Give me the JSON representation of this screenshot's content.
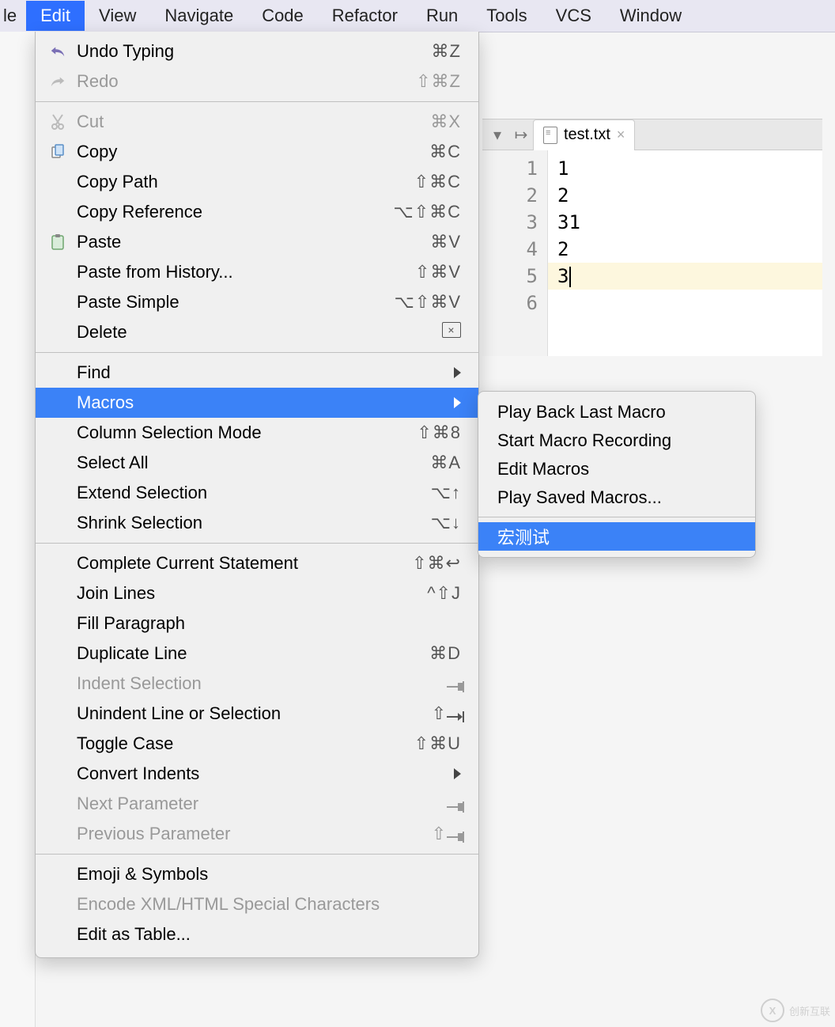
{
  "menubar": {
    "partial_left": "le",
    "items": [
      "Edit",
      "View",
      "Navigate",
      "Code",
      "Refactor",
      "Run",
      "Tools",
      "VCS",
      "Window"
    ],
    "active_index": 0
  },
  "edit_menu": [
    {
      "icon": "undo-icon",
      "label": "Undo Typing",
      "shortcut": "⌘Z"
    },
    {
      "icon": "redo-icon",
      "label": "Redo",
      "shortcut": "⇧⌘Z",
      "disabled": true
    },
    {
      "sep": true
    },
    {
      "icon": "cut-icon",
      "label": "Cut",
      "shortcut": "⌘X",
      "disabled": true
    },
    {
      "icon": "copy-icon",
      "label": "Copy",
      "shortcut": "⌘C"
    },
    {
      "label": "Copy Path",
      "shortcut": "⇧⌘C"
    },
    {
      "label": "Copy Reference",
      "shortcut": "⌥⇧⌘C"
    },
    {
      "icon": "paste-icon",
      "label": "Paste",
      "shortcut": "⌘V"
    },
    {
      "label": "Paste from History...",
      "shortcut": "⇧⌘V"
    },
    {
      "label": "Paste Simple",
      "shortcut": "⌥⇧⌘V"
    },
    {
      "label": "Delete",
      "shortcut_glyph": "delete"
    },
    {
      "sep": true
    },
    {
      "label": "Find",
      "submenu": true
    },
    {
      "label": "Macros",
      "submenu": true,
      "highlight": true
    },
    {
      "label": "Column Selection Mode",
      "shortcut": "⇧⌘8"
    },
    {
      "label": "Select All",
      "shortcut": "⌘A"
    },
    {
      "label": "Extend Selection",
      "shortcut": "⌥↑"
    },
    {
      "label": "Shrink Selection",
      "shortcut": "⌥↓"
    },
    {
      "sep": true
    },
    {
      "label": "Complete Current Statement",
      "shortcut": "⇧⌘↩"
    },
    {
      "label": "Join Lines",
      "shortcut": "^⇧J"
    },
    {
      "label": "Fill Paragraph"
    },
    {
      "label": "Duplicate Line",
      "shortcut": "⌘D"
    },
    {
      "label": "Indent Selection",
      "shortcut_glyph": "tab",
      "disabled": true
    },
    {
      "label": "Unindent Line or Selection",
      "shortcut": "⇧",
      "shortcut_glyph": "tab"
    },
    {
      "label": "Toggle Case",
      "shortcut": "⇧⌘U"
    },
    {
      "label": "Convert Indents",
      "submenu": true
    },
    {
      "label": "Next Parameter",
      "shortcut_glyph": "tab",
      "disabled": true
    },
    {
      "label": "Previous Parameter",
      "shortcut": "⇧",
      "shortcut_glyph": "tab",
      "disabled": true
    },
    {
      "sep": true
    },
    {
      "label": "Emoji & Symbols"
    },
    {
      "label": "Encode XML/HTML Special Characters",
      "disabled": true
    },
    {
      "label": "Edit as Table..."
    }
  ],
  "macros_submenu": [
    {
      "label": "Play Back Last Macro"
    },
    {
      "label": "Start Macro Recording"
    },
    {
      "label": "Edit Macros"
    },
    {
      "label": "Play Saved Macros..."
    },
    {
      "sep": true
    },
    {
      "label": "宏测试",
      "highlight": true
    }
  ],
  "editor": {
    "tab_name": "test.txt",
    "lines": [
      "1",
      "2",
      "31",
      "2",
      "3",
      ""
    ],
    "current_line_index": 4
  },
  "watermark": {
    "text": "创新互联"
  }
}
